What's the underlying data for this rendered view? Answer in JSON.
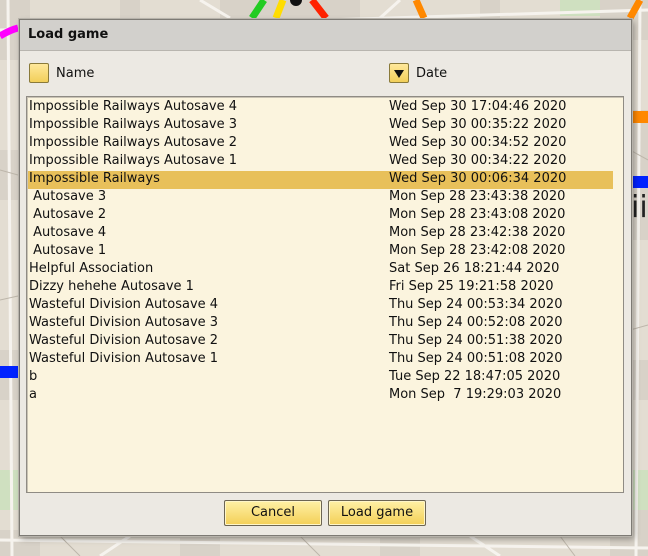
{
  "dialog": {
    "title": "Load game",
    "columns": {
      "name": "Name",
      "date": "Date"
    },
    "sort": {
      "name_indicator": "none",
      "date_indicator": "descending"
    },
    "rows": [
      {
        "name": "Impossible Railways Autosave 4",
        "date": "Wed Sep 30 17:04:46 2020"
      },
      {
        "name": "Impossible Railways Autosave 3",
        "date": "Wed Sep 30 00:35:22 2020"
      },
      {
        "name": "Impossible Railways Autosave 2",
        "date": "Wed Sep 30 00:34:52 2020"
      },
      {
        "name": "Impossible Railways Autosave 1",
        "date": "Wed Sep 30 00:34:22 2020"
      },
      {
        "name": "Impossible Railways",
        "date": "Wed Sep 30 00:06:34 2020",
        "selected": true
      },
      {
        "name": " Autosave 3",
        "date": "Mon Sep 28 23:43:38 2020"
      },
      {
        "name": " Autosave 2",
        "date": "Mon Sep 28 23:43:08 2020"
      },
      {
        "name": " Autosave 4",
        "date": "Mon Sep 28 23:42:38 2020"
      },
      {
        "name": " Autosave 1",
        "date": "Mon Sep 28 23:42:08 2020"
      },
      {
        "name": "Helpful Association",
        "date": "Sat Sep 26 18:21:44 2020"
      },
      {
        "name": "Dizzy hehehe Autosave 1",
        "date": "Fri Sep 25 19:21:58 2020"
      },
      {
        "name": "Wasteful Division Autosave 4",
        "date": "Thu Sep 24 00:53:34 2020"
      },
      {
        "name": "Wasteful Division Autosave 3",
        "date": "Thu Sep 24 00:52:08 2020"
      },
      {
        "name": "Wasteful Division Autosave 2",
        "date": "Thu Sep 24 00:51:38 2020"
      },
      {
        "name": "Wasteful Division Autosave 1",
        "date": "Thu Sep 24 00:51:08 2020"
      },
      {
        "name": "b",
        "date": "Tue Sep 22 18:47:05 2020"
      },
      {
        "name": "a",
        "date": "Mon Sep  7 19:29:03 2020"
      }
    ],
    "buttons": {
      "cancel": "Cancel",
      "load": "Load game"
    }
  },
  "map": {
    "partial_label": "ii"
  },
  "colors": {
    "selection": "#e8c05a",
    "list_bg": "#fbf4de",
    "button": "#f3cf56",
    "rail_lines": [
      "#ff00ff",
      "#22cc22",
      "#ff2200",
      "#ff8800",
      "#0022ff"
    ]
  }
}
